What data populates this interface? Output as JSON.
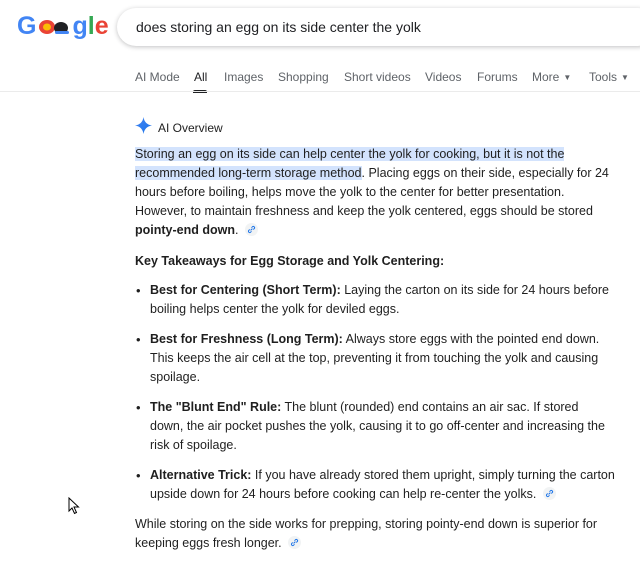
{
  "header": {
    "logo_letters": [
      "G",
      "g",
      "l",
      "e"
    ],
    "logo_alt": "Google",
    "search_query": "does storing an egg on its side center the yolk"
  },
  "tabs": [
    {
      "label": "AI Mode",
      "active": false
    },
    {
      "label": "All",
      "active": true
    },
    {
      "label": "Images",
      "active": false
    },
    {
      "label": "Shopping",
      "active": false
    },
    {
      "label": "Short videos",
      "active": false
    },
    {
      "label": "Videos",
      "active": false
    },
    {
      "label": "Forums",
      "active": false
    },
    {
      "label": "More",
      "active": false,
      "dropdown": true
    },
    {
      "label": "Tools",
      "active": false,
      "dropdown": true
    }
  ],
  "ai_overview": {
    "label": "AI Overview",
    "intro_highlight": "Storing an egg on its side can help center the yolk for cooking, but it is not the recommended long-term storage method",
    "intro_rest": ". Placing eggs on their side, especially for 24 hours before boiling, helps move the yolk to the center for better presentation. However, to maintain freshness and keep the yolk centered, eggs should be stored ",
    "intro_bold": "pointy-end down",
    "intro_end": ".",
    "takeaways_heading": "Key Takeaways for Egg Storage and Yolk Centering:",
    "bullets": [
      {
        "title": "Best for Centering (Short Term):",
        "text": " Laying the carton on its side for 24 hours before boiling helps center the yolk for deviled eggs."
      },
      {
        "title": "Best for Freshness (Long Term):",
        "text": " Always store eggs with the pointed end down. This keeps the air cell at the top, preventing it from touching the yolk and causing spoilage."
      },
      {
        "title": "The \"Blunt End\" Rule:",
        "text": " The blunt (rounded) end contains an air sac. If stored down, the air pocket pushes the yolk, causing it to go off-center and increasing the risk of spoilage."
      },
      {
        "title": "Alternative Trick:",
        "text": " If you have already stored them upright, simply turning the carton upside down for 24 hours before cooking can help re-center the yolks."
      }
    ],
    "closing": "While storing on the side works for prepping, storing pointy-end down is superior for keeping eggs fresh longer."
  },
  "colors": {
    "google_blue": "#4285f4",
    "google_red": "#ea4335",
    "google_yellow": "#fbbc05",
    "google_green": "#34a853",
    "highlight": "#d3e3fd"
  },
  "icons": [
    "sparkle-icon",
    "link-icon",
    "chevron-down-icon",
    "mouse-cursor-icon"
  ]
}
